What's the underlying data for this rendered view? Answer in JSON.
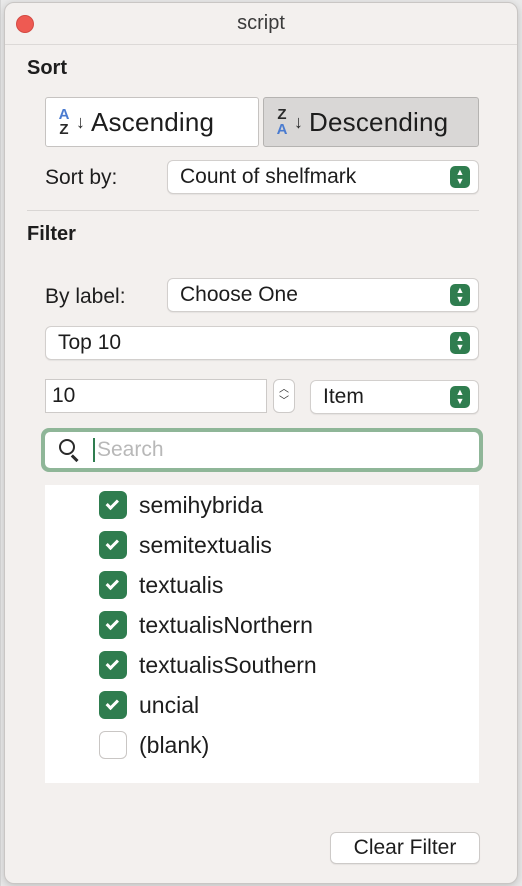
{
  "window": {
    "title": "script"
  },
  "sort": {
    "heading": "Sort",
    "ascending": {
      "label": "Ascending",
      "icon_top": "A",
      "icon_bottom": "Z",
      "arrow": "↓"
    },
    "descending": {
      "label": "Descending",
      "icon_top": "Z",
      "icon_bottom": "A",
      "arrow": "↓",
      "selected": true
    },
    "sort_by_label": "Sort by:",
    "sort_by_value": "Count of shelfmark"
  },
  "filter": {
    "heading": "Filter",
    "by_label_label": "By label:",
    "by_label_value": "Choose One",
    "top_mode": "Top 10",
    "count_value": "10",
    "unit_value": "Item",
    "search_placeholder": "Search",
    "items": [
      {
        "label": "semihybrida",
        "checked": true
      },
      {
        "label": "semitextualis",
        "checked": true
      },
      {
        "label": "textualis",
        "checked": true
      },
      {
        "label": "textualisNorthern",
        "checked": true
      },
      {
        "label": "textualisSouthern",
        "checked": true
      },
      {
        "label": "uncial",
        "checked": true
      },
      {
        "label": "(blank)",
        "checked": false
      }
    ],
    "clear_button": "Clear Filter"
  },
  "colors": {
    "accent": "#2f7d4f",
    "focus_ring": "#8fb698",
    "close": "#ee5a52"
  },
  "icons": {
    "close": "close-icon",
    "search": "search-icon",
    "popup": "chevron-updown-icon",
    "check": "checkmark-icon"
  }
}
